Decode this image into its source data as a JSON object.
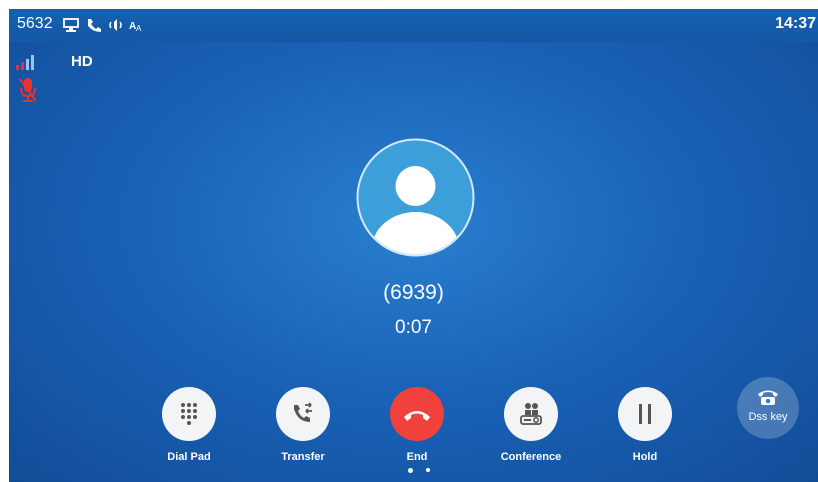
{
  "status_bar": {
    "extension": "5632",
    "time": "14:37",
    "icons": [
      "account-icon",
      "phone-icon",
      "speaker-icon",
      "input-method-icon"
    ]
  },
  "call": {
    "quality_badge": "HD",
    "number": "(6939)",
    "duration": "0:07",
    "signal_icon": "signal-strength-icon",
    "muted_icon": "microphone-muted-icon"
  },
  "actions": [
    {
      "label": "Dial Pad",
      "icon": "dialpad-icon"
    },
    {
      "label": "Transfer",
      "icon": "transfer-icon"
    },
    {
      "label": "End",
      "icon": "end-call-icon",
      "color": "#f0413d"
    },
    {
      "label": "Conference",
      "icon": "conference-icon"
    },
    {
      "label": "Hold",
      "icon": "hold-icon"
    }
  ],
  "dss_key": {
    "label": "Dss key",
    "icon": "dss-phone-icon"
  },
  "pagination": {
    "pages": 2,
    "current": 1
  },
  "colors": {
    "background": "#1a63b8",
    "status_bar": "#1461b0",
    "end_button": "#f0413d",
    "muted_red": "#e8322f",
    "avatar_bg": "#3d9fd9"
  }
}
